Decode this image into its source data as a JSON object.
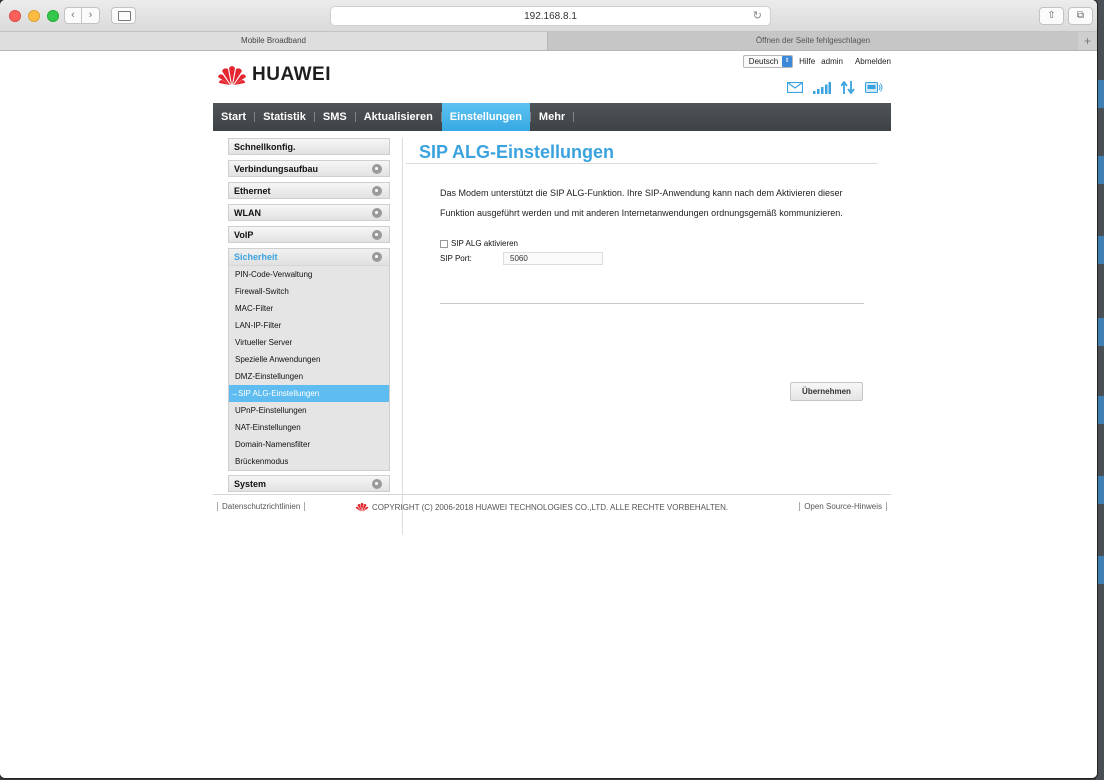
{
  "browser": {
    "url": "192.168.8.1",
    "tabs": [
      {
        "label": "Mobile Broadband"
      },
      {
        "label": "Öffnen der Seite fehlgeschlagen"
      }
    ],
    "new_tab_label": "+"
  },
  "header": {
    "language": "Deutsch",
    "help": "Hilfe",
    "user": "admin",
    "logout": "Abmelden",
    "brand": "HUAWEI"
  },
  "mainnav": {
    "items": [
      {
        "label": "Start"
      },
      {
        "label": "Statistik"
      },
      {
        "label": "SMS"
      },
      {
        "label": "Aktualisieren"
      },
      {
        "label": "Einstellungen"
      },
      {
        "label": "Mehr"
      }
    ],
    "active": "Einstellungen"
  },
  "sidebar": {
    "groups": [
      {
        "label": "Schnellkonfig."
      },
      {
        "label": "Verbindungsaufbau"
      },
      {
        "label": "Ethernet"
      },
      {
        "label": "WLAN"
      },
      {
        "label": "VoIP"
      }
    ],
    "open_group": {
      "label": "Sicherheit",
      "items": [
        {
          "label": "PIN-Code-Verwaltung"
        },
        {
          "label": "Firewall-Switch"
        },
        {
          "label": "MAC-Filter"
        },
        {
          "label": "LAN-IP-Filter"
        },
        {
          "label": "Virtueller Server"
        },
        {
          "label": "Spezielle Anwendungen"
        },
        {
          "label": "DMZ-Einstellungen"
        },
        {
          "label": "→SIP ALG-Einstellungen"
        },
        {
          "label": "UPnP-Einstellungen"
        },
        {
          "label": "NAT-Einstellungen"
        },
        {
          "label": "Domain-Namensfilter"
        },
        {
          "label": "Brückenmodus"
        }
      ]
    },
    "last_group": {
      "label": "System"
    }
  },
  "content": {
    "title": "SIP ALG-Einstellungen",
    "description": "Das Modem unterstützt die SIP ALG-Funktion. Ihre SIP-Anwendung kann nach dem Aktivieren dieser Funktion ausgeführt werden und mit anderen Internetanwendungen ordnungsgemäß kommunizieren.",
    "checkbox_label": "SIP ALG aktivieren",
    "port_label": "SIP Port:",
    "port_value": "5060",
    "apply_label": "Übernehmen"
  },
  "footer": {
    "privacy": "Datenschutzrichtlinien",
    "copyright": "COPYRIGHT (C) 2006-2018 HUAWEI TECHNOLOGIES CO.,LTD. ALLE RECHTE VORBEHALTEN.",
    "open_source": "Open Source-Hinweis"
  },
  "colors": {
    "accent": "#3aa3df",
    "nav_bg": "#464b4f",
    "brand_red": "#e3262f"
  }
}
